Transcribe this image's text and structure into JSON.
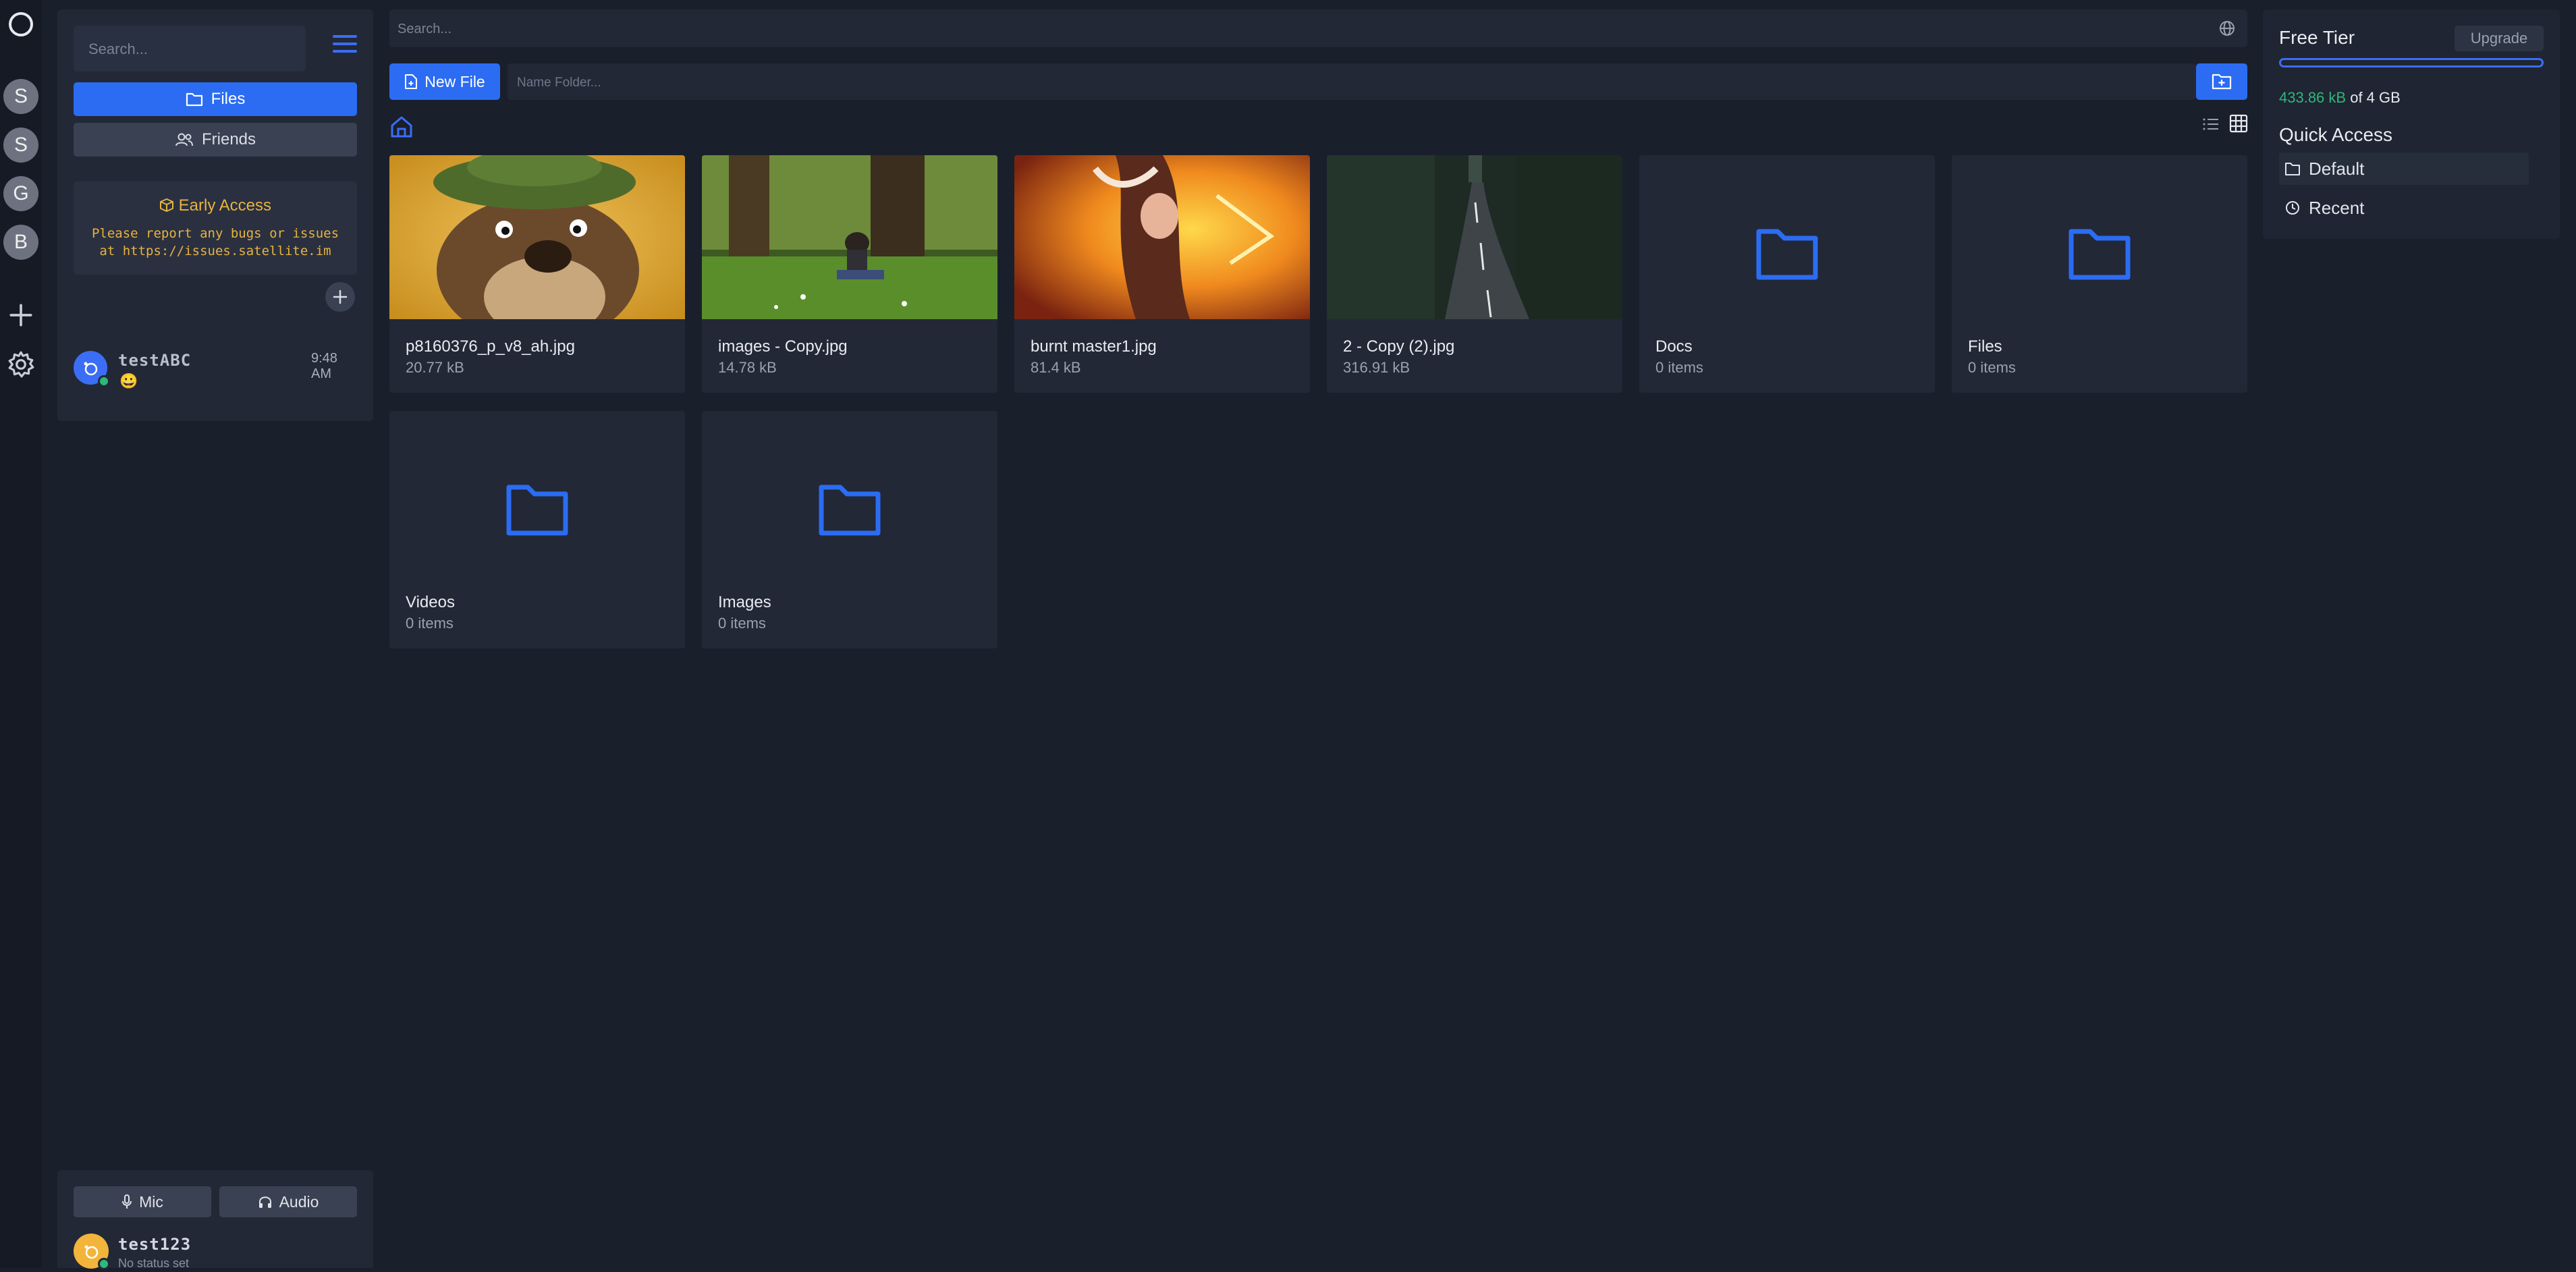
{
  "rail": {
    "servers": [
      "S",
      "S",
      "G",
      "B"
    ]
  },
  "sidebar": {
    "search_placeholder": "Search...",
    "nav": {
      "files": "Files",
      "friends": "Friends"
    },
    "early_access": {
      "title": "Early Access",
      "body": "Please report any bugs or issues at https://issues.satellite.im"
    },
    "chat": {
      "name": "testABC",
      "time": "9:48 AM",
      "preview": "😀"
    },
    "controls": {
      "mic": "Mic",
      "audio": "Audio"
    },
    "me": {
      "name": "test123",
      "status": "No status set"
    }
  },
  "main": {
    "search_placeholder": "Search...",
    "new_file_label": "New File",
    "folder_placeholder": "Name Folder...",
    "items": [
      {
        "name": "p8160376_p_v8_ah.jpg",
        "meta": "20.77 kB",
        "kind": "image"
      },
      {
        "name": "images - Copy.jpg",
        "meta": "14.78 kB",
        "kind": "image"
      },
      {
        "name": "burnt master1.jpg",
        "meta": "81.4 kB",
        "kind": "image"
      },
      {
        "name": "2 - Copy (2).jpg",
        "meta": "316.91 kB",
        "kind": "image"
      },
      {
        "name": "Docs",
        "meta": "0 items",
        "kind": "folder"
      },
      {
        "name": "Files",
        "meta": "0 items",
        "kind": "folder"
      },
      {
        "name": "Videos",
        "meta": "0 items",
        "kind": "folder"
      },
      {
        "name": "Images",
        "meta": "0 items",
        "kind": "folder"
      }
    ]
  },
  "storage": {
    "tier": "Free Tier",
    "upgrade_label": "Upgrade",
    "used": "433.86 kB",
    "of_label": "of 4 GB",
    "used_fraction": 0.0001
  },
  "quick_access": {
    "title": "Quick Access",
    "items": [
      "Default",
      "Recent"
    ]
  },
  "colors": {
    "accent": "#2b6cf3",
    "online": "#2eb87a",
    "warning": "#e7b33f"
  }
}
